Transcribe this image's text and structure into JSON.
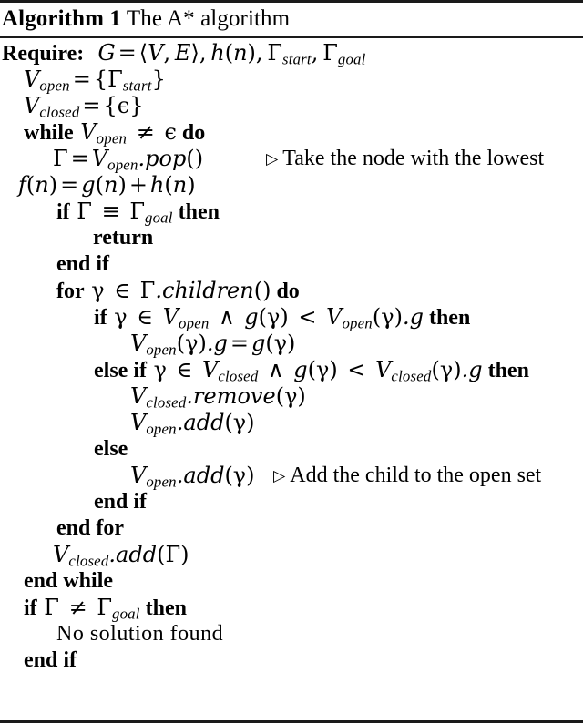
{
  "algorithm": {
    "label": "Algorithm 1",
    "title": "The A* algorithm",
    "require_keyword": "Require:",
    "require_expression": "G = ⟨V, E⟩, h(n), Γstart, Γgoal",
    "lines": [
      {
        "id": "require",
        "indent": 0,
        "text": "Require: G = ⟨V, E⟩, h(n), Γ_start, Γ_goal"
      },
      {
        "id": "init-open",
        "indent": 1,
        "text": "V_open = {Γ_start}"
      },
      {
        "id": "init-closed",
        "indent": 1,
        "text": "V_closed = {ε}"
      },
      {
        "id": "while-open",
        "indent": 1,
        "text": "while V_open ≠ ε do"
      },
      {
        "id": "pop",
        "indent": 2,
        "text": "Γ = V_open.pop()",
        "comment": "▷ Take the node with the lowest"
      },
      {
        "id": "fn-cont",
        "indent": 0,
        "text": "f(n) = g(n) + h(n)"
      },
      {
        "id": "if-goal",
        "indent": 3,
        "text": "if Γ ≡ Γ_goal then"
      },
      {
        "id": "return",
        "indent": 4,
        "text": "return"
      },
      {
        "id": "end-if-goal",
        "indent": 3,
        "text": "end if"
      },
      {
        "id": "for-children",
        "indent": 3,
        "text": "for γ ∈ Γ.children() do"
      },
      {
        "id": "if-in-open",
        "indent": 4,
        "text": "if γ ∈ V_open ∧ g(γ) < V_open(γ).g then"
      },
      {
        "id": "update-open-g",
        "indent": 5,
        "text": "V_open(γ).g = g(γ)"
      },
      {
        "id": "else-if-closed",
        "indent": 4,
        "text": "else if γ ∈ V_closed ∧ g(γ) < V_closed(γ).g then"
      },
      {
        "id": "closed-remove",
        "indent": 5,
        "text": "V_closed.remove(γ)"
      },
      {
        "id": "open-add-1",
        "indent": 5,
        "text": "V_open.add(γ)"
      },
      {
        "id": "else",
        "indent": 4,
        "text": "else"
      },
      {
        "id": "open-add-2",
        "indent": 5,
        "text": "V_open.add(γ)",
        "comment": "▷ Add the child to the open set"
      },
      {
        "id": "end-if-inner",
        "indent": 4,
        "text": "end if"
      },
      {
        "id": "end-for",
        "indent": 3,
        "text": "end for"
      },
      {
        "id": "closed-add",
        "indent": 2,
        "text": "V_closed.add(Γ)"
      },
      {
        "id": "end-while",
        "indent": 1,
        "text": "end while"
      },
      {
        "id": "if-not-goal",
        "indent": 1,
        "text": "if Γ ≠ Γ_goal then"
      },
      {
        "id": "no-solution",
        "indent": 2,
        "text": "No solution found"
      },
      {
        "id": "end-if-final",
        "indent": 1,
        "text": "end if"
      }
    ],
    "keywords": {
      "require": "Require:",
      "while": "while",
      "do": "do",
      "if": "if",
      "then": "then",
      "return": "return",
      "end_if": "end if",
      "for": "for",
      "else": "else",
      "else_if": "else if",
      "end_for": "end for",
      "end_while": "end while",
      "no_solution": "No solution found"
    },
    "comments": {
      "pop": "Take the node with the lowest",
      "open_add": "Add the child to the open set"
    },
    "symbols": {
      "triangle": "▷",
      "epsilon": "ε",
      "gamma_upper": "Γ",
      "gamma_lower": "γ",
      "not_equal": "≠",
      "identical": "≡",
      "element_of": "∈",
      "logical_and": "∧",
      "less_than": "<",
      "angle_open": "⟨",
      "angle_close": "⟩"
    },
    "colors": {
      "text": "#000000",
      "rule": "#1a1a1a",
      "background": "#ffffff"
    }
  }
}
